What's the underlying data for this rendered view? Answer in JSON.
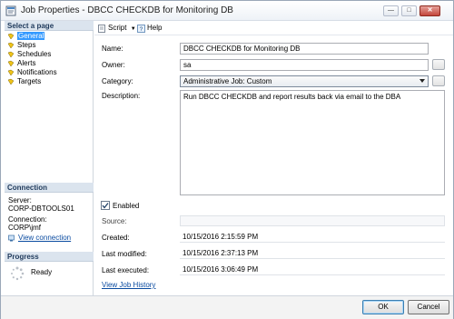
{
  "window": {
    "title": "Job Properties - DBCC CHECKDB for Monitoring DB",
    "controls": {
      "minimize": "—",
      "maximize": "□",
      "close": "✕"
    }
  },
  "left_pane": {
    "select_page_header": "Select a page",
    "pages": [
      {
        "label": "General",
        "icon": "page-icon",
        "selected": true
      },
      {
        "label": "Steps",
        "icon": "page-icon"
      },
      {
        "label": "Schedules",
        "icon": "page-icon"
      },
      {
        "label": "Alerts",
        "icon": "page-icon"
      },
      {
        "label": "Notifications",
        "icon": "page-icon"
      },
      {
        "label": "Targets",
        "icon": "page-icon"
      }
    ],
    "connection_header": "Connection",
    "server_label": "Server:",
    "server_value": "CORP-DBTOOLS01",
    "connection_label": "Connection:",
    "connection_value": "CORP\\jmf",
    "view_connection_link": "View connection",
    "progress_header": "Progress",
    "progress_status": "Ready"
  },
  "toolbar": {
    "script_label": "Script",
    "help_label": "Help"
  },
  "form": {
    "name_label": "Name:",
    "name_value": "DBCC CHECKDB for Monitoring DB",
    "owner_label": "Owner:",
    "owner_value": "sa",
    "category_label": "Category:",
    "category_value": "Administrative Job: Custom",
    "description_label": "Description:",
    "description_value": "Run DBCC CHECKDB and report results back via email to the DBA",
    "enabled_label": "Enabled",
    "enabled_checked": true,
    "source_label": "Source:",
    "source_value": "",
    "created_label": "Created:",
    "created_value": "10/15/2016 2:15:59 PM",
    "last_modified_label": "Last modified:",
    "last_modified_value": "10/15/2016 2:37:13 PM",
    "last_executed_label": "Last executed:",
    "last_executed_value": "10/15/2016 3:06:49 PM",
    "view_history_link": "View Job History"
  },
  "buttons": {
    "ok": "OK",
    "cancel": "Cancel"
  },
  "colors": {
    "selection": "#3399ff",
    "section_header_bg": "#dbe4ee",
    "link": "#0a4ba0"
  }
}
